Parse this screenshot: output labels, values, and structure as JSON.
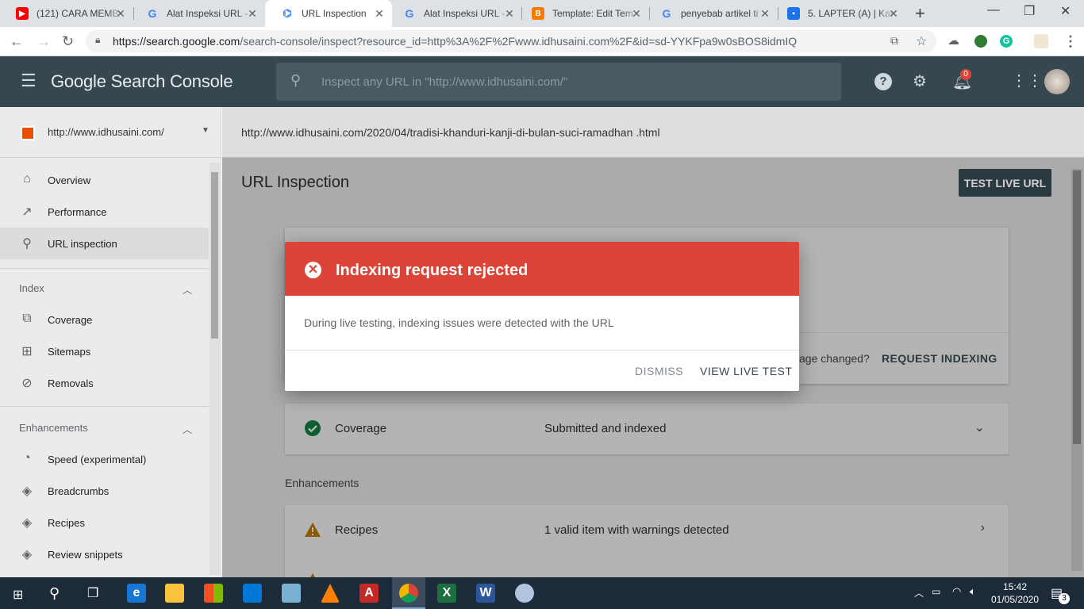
{
  "browser": {
    "tabs": [
      {
        "title": "(121) CARA MEMB",
        "icon": "youtube-icon",
        "color": "#ff0000"
      },
      {
        "title": "Alat Inspeksi URL -",
        "icon": "google-icon",
        "color": "#4285f4"
      },
      {
        "title": "URL Inspection",
        "icon": "search-console-icon",
        "color": "#4285f4",
        "active": true
      },
      {
        "title": "Alat Inspeksi URL -",
        "icon": "google-icon",
        "color": "#4285f4"
      },
      {
        "title": "Template: Edit Tem",
        "icon": "blogger-icon",
        "color": "#f57c00"
      },
      {
        "title": "penyebab artikel ti",
        "icon": "google-icon",
        "color": "#4285f4"
      },
      {
        "title": "5. LAPTER (A) | Kar",
        "icon": "classroom-icon",
        "color": "#1a73e8"
      }
    ],
    "url_host": "https://search.google.com",
    "url_path": "/search-console/inspect?resource_id=http%3A%2F%2Fwww.idhusaini.com%2F&id=sd-YYKFpa9w0sBOS8idmIQ"
  },
  "header": {
    "brand": "Google Search Console",
    "search_placeholder": "Inspect any URL in \"http://www.idhusaini.com/\"",
    "notification_count": "0"
  },
  "sidebar": {
    "property": "http://www.idhusaini.com/",
    "items": [
      {
        "label": "Overview",
        "icon": "home-icon"
      },
      {
        "label": "Performance",
        "icon": "trending-up-icon"
      },
      {
        "label": "URL inspection",
        "icon": "search-icon",
        "selected": true
      }
    ],
    "index_section": "Index",
    "index_items": [
      {
        "label": "Coverage",
        "icon": "copy-icon"
      },
      {
        "label": "Sitemaps",
        "icon": "sitemap-icon"
      },
      {
        "label": "Removals",
        "icon": "eye-off-icon"
      }
    ],
    "enh_section": "Enhancements",
    "enh_items": [
      {
        "label": "Speed (experimental)",
        "icon": "speedometer-icon"
      },
      {
        "label": "Breadcrumbs",
        "icon": "layers-icon"
      },
      {
        "label": "Recipes",
        "icon": "layers-icon"
      },
      {
        "label": "Review snippets",
        "icon": "layers-icon"
      }
    ]
  },
  "main": {
    "inspected_url": "http://www.idhusaini.com/2020/04/tradisi-khanduri-kanji-di-bulan-suci-ramadhan .html",
    "title": "URL Inspection",
    "test_live_button": "TEST LIVE URL",
    "page_changed_text": "age changed?",
    "request_indexing": "REQUEST INDEXING",
    "coverage_label": "Coverage",
    "coverage_value": "Submitted and indexed",
    "enhancements_heading": "Enhancements",
    "recipes_label": "Recipes",
    "recipes_value": "1 valid item with warnings detected"
  },
  "dialog": {
    "title": "Indexing request rejected",
    "body": "During live testing, indexing issues were detected with the URL",
    "dismiss": "DISMISS",
    "view_live_test": "VIEW LIVE TEST",
    "header_color": "#db4437"
  },
  "taskbar": {
    "time": "15:42",
    "date": "01/05/2020",
    "notifications": "3"
  }
}
